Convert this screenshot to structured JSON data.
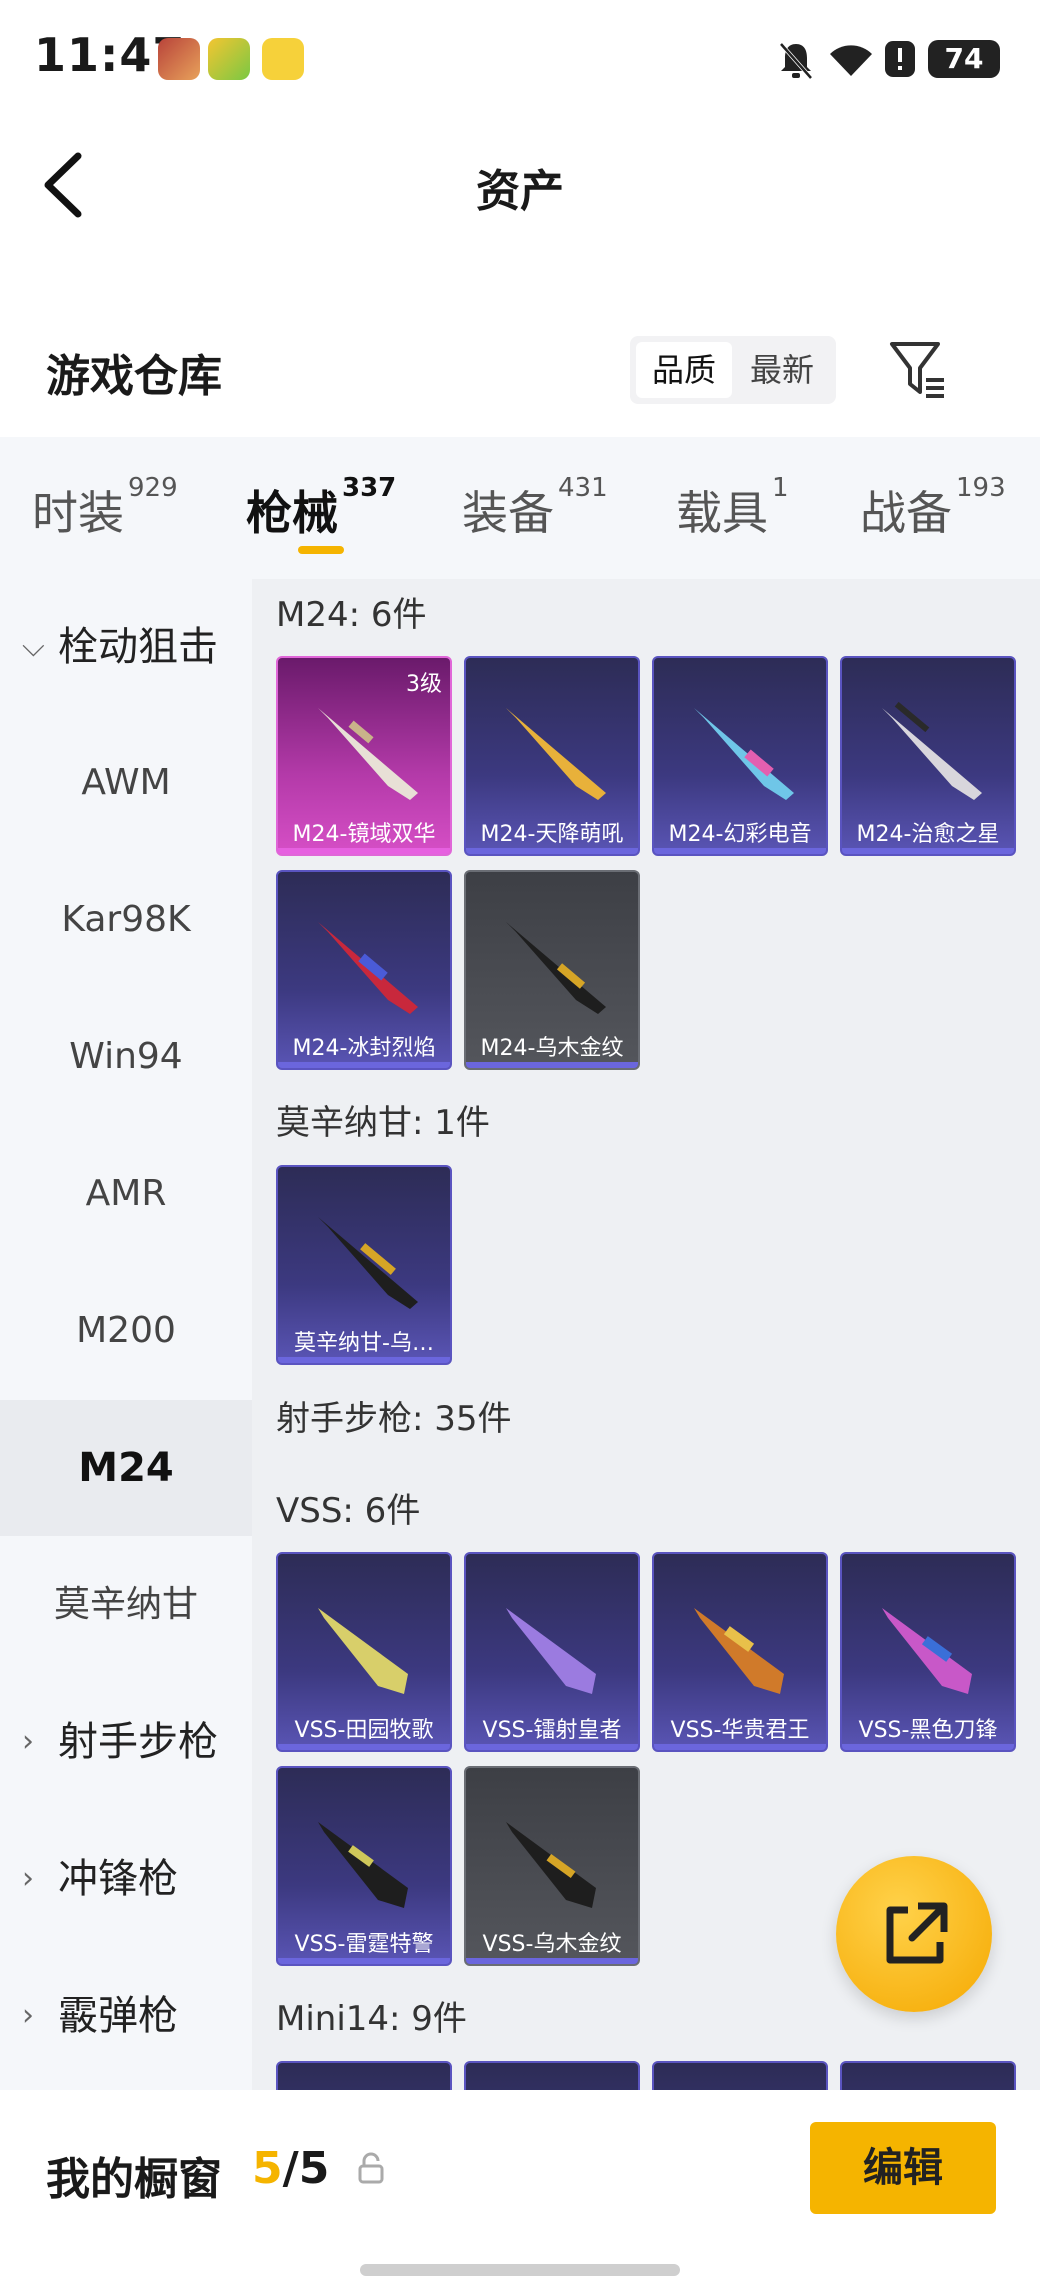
{
  "status_bar": {
    "time": "11:47",
    "battery": "74"
  },
  "header": {
    "title": "资产"
  },
  "warehouse": {
    "title": "游戏仓库",
    "sort": [
      "品质",
      "最新"
    ]
  },
  "tabs": [
    {
      "label": "时装",
      "count": "929"
    },
    {
      "label": "枪械",
      "count": "337"
    },
    {
      "label": "装备",
      "count": "431"
    },
    {
      "label": "载具",
      "count": "1"
    },
    {
      "label": "战备",
      "count": "193"
    }
  ],
  "sidebar": [
    {
      "label": "栓动狙击"
    },
    {
      "label": "AWM"
    },
    {
      "label": "Kar98K"
    },
    {
      "label": "Win94"
    },
    {
      "label": "AMR"
    },
    {
      "label": "M200"
    },
    {
      "label": "M24"
    },
    {
      "label": "莫辛纳甘"
    },
    {
      "label": "射手步枪"
    },
    {
      "label": "冲锋枪"
    },
    {
      "label": "霰弹枪"
    }
  ],
  "sections": {
    "m24": "M24: 6件",
    "mosin": "莫辛纳甘: 1件",
    "dmr": "射手步枪: 35件",
    "vss": "VSS: 6件",
    "mini14": "Mini14: 9件"
  },
  "cards": {
    "m24": [
      {
        "name": "M24-镜域双华",
        "level": "3级"
      },
      {
        "name": "M24-天降萌吼"
      },
      {
        "name": "M24-幻彩电音"
      },
      {
        "name": "M24-治愈之星"
      },
      {
        "name": "M24-冰封烈焰"
      },
      {
        "name": "M24-乌木金纹"
      }
    ],
    "mosin": [
      {
        "name": "莫辛纳甘-乌…"
      }
    ],
    "vss": [
      {
        "name": "VSS-田园牧歌"
      },
      {
        "name": "VSS-镭射皇者"
      },
      {
        "name": "VSS-华贵君王"
      },
      {
        "name": "VSS-黑色刀锋"
      },
      {
        "name": "VSS-雷霆特警"
      },
      {
        "name": "VSS-乌木金纹"
      }
    ]
  },
  "showcase": {
    "title": "我的橱窗",
    "current": "5",
    "sep": "/",
    "total": "5",
    "edit_label": "编辑"
  },
  "colors": {
    "accent": "#f5b400",
    "card_purple": "#3c3980",
    "card_pink": "#b43aa9",
    "card_gray": "#54565c"
  }
}
